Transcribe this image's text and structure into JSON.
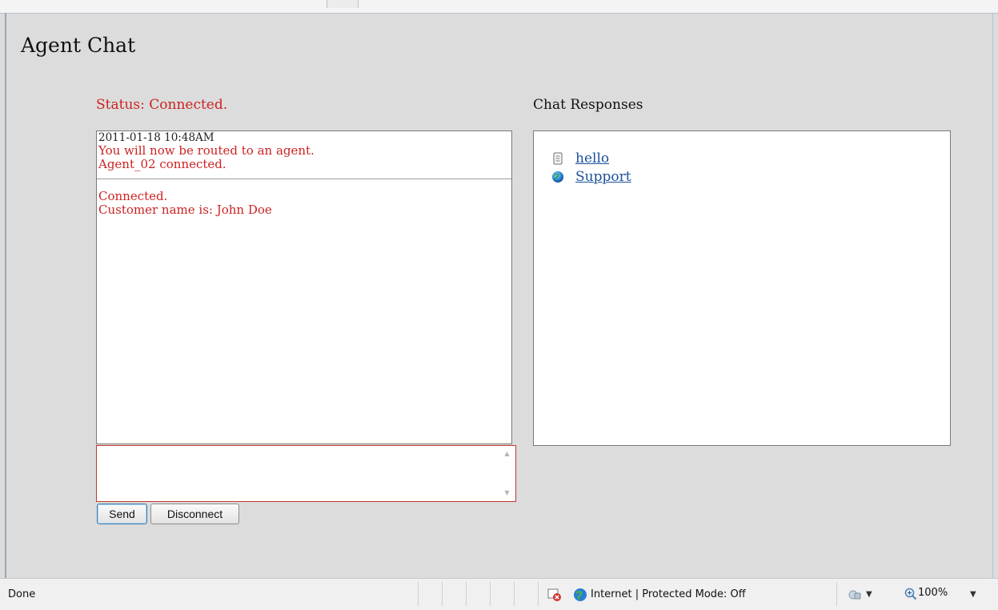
{
  "page": {
    "title": "Agent Chat",
    "status": "Status: Connected.",
    "responses_heading": "Chat Responses"
  },
  "chat_log": {
    "entries": [
      {
        "timestamp": "2011-01-18 10:48AM",
        "lines": [
          "You will now be routed to an agent.",
          "Agent_02 connected."
        ]
      },
      {
        "lines": [
          "Connected.",
          "Customer name is: John Doe"
        ]
      }
    ]
  },
  "message_input": {
    "value": ""
  },
  "buttons": {
    "send": "Send",
    "disconnect": "Disconnect"
  },
  "responses": [
    {
      "label": "hello",
      "icon": "document-icon"
    },
    {
      "label": "Support",
      "icon": "globe-icon"
    }
  ],
  "statusbar": {
    "text": "Done",
    "zone": "Internet | Protected Mode: Off",
    "zoom": "100%"
  },
  "colors": {
    "status_red": "#cc2222",
    "link_blue": "#1a4f9a",
    "input_border": "#c0392b",
    "page_bg": "#dcdcdc"
  }
}
